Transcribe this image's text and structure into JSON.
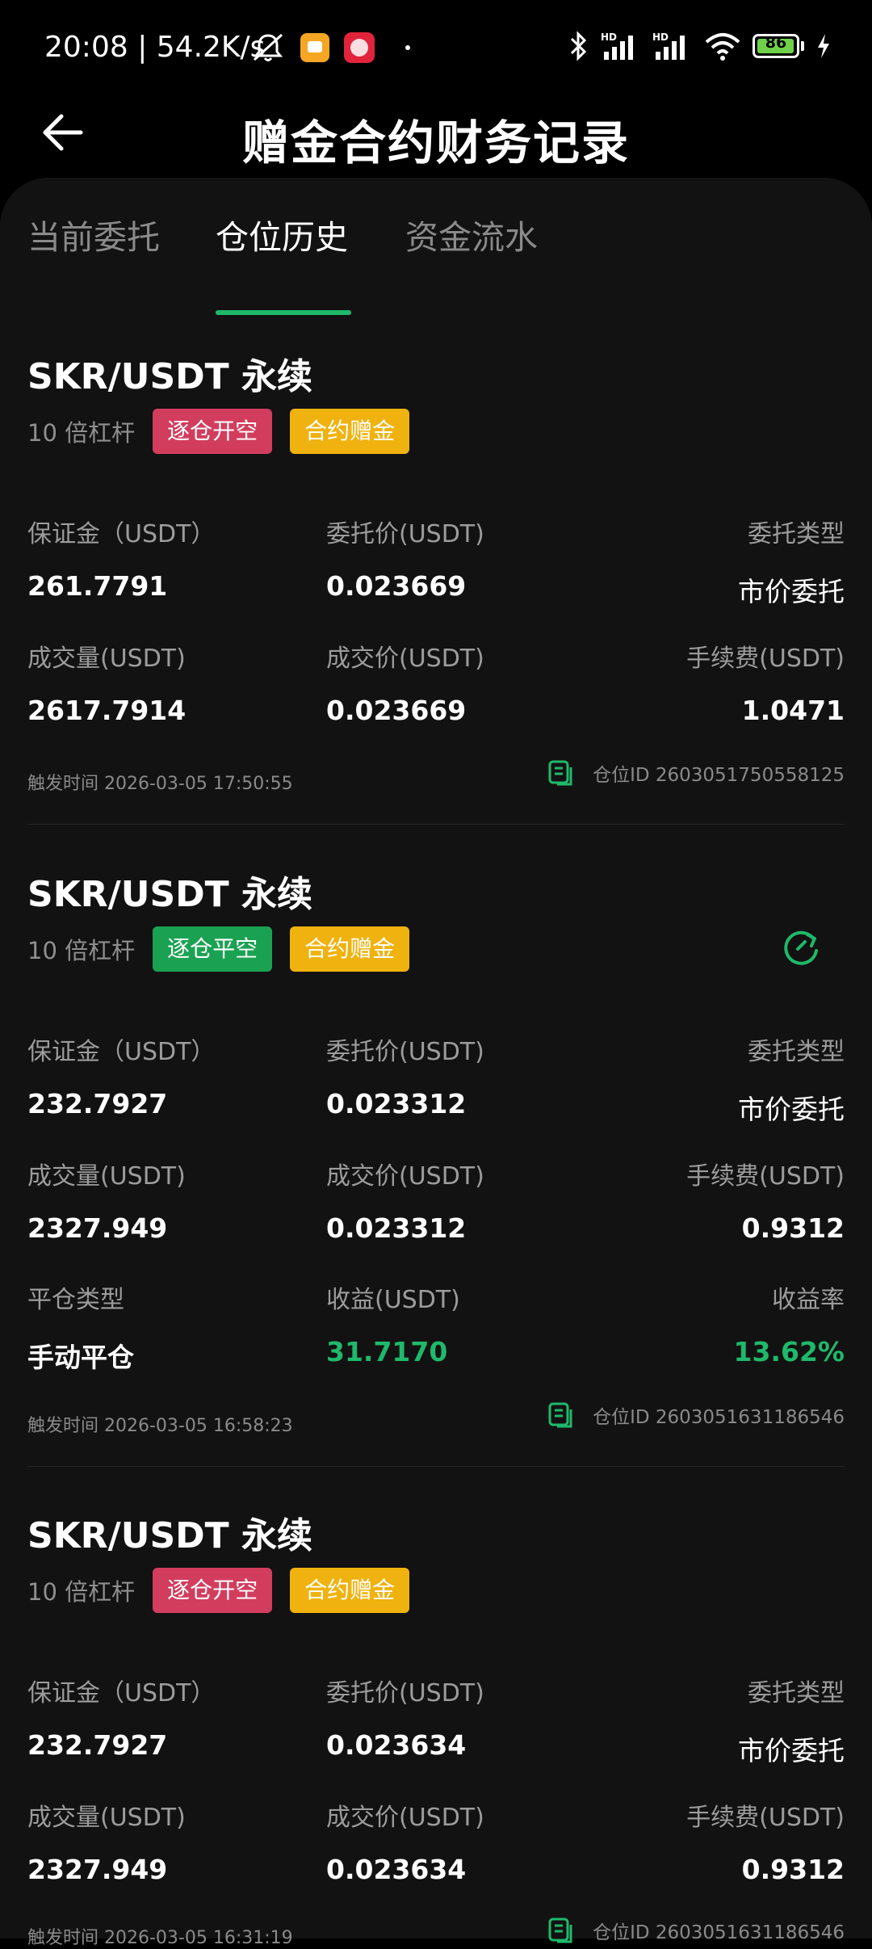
{
  "status_bar": {
    "time": "20:08 | 54.2K/s",
    "battery": "86"
  },
  "header": {
    "title": "赠金合约财务记录"
  },
  "tabs": [
    {
      "label": "当前委托",
      "active": false
    },
    {
      "label": "仓位历史",
      "active": true
    },
    {
      "label": "资金流水",
      "active": false
    }
  ],
  "labels": {
    "margin": "保证金（USDT）",
    "order_price": "委托价(USDT)",
    "order_type": "委托类型",
    "volume": "成交量(USDT)",
    "fill_price": "成交价(USDT)",
    "fee": "手续费(USDT)",
    "close_type": "平仓类型",
    "pnl": "收益(USDT)",
    "pnl_rate": "收益率"
  },
  "records": [
    {
      "pair": "SKR/USDT 永续",
      "leverage": "10 倍杠杆",
      "tag_action": "逐仓开空",
      "tag_kind": "合约赠金",
      "margin": "261.7791",
      "order_price": "0.023669",
      "order_type": "市价委托",
      "volume": "2617.7914",
      "fill_price": "0.023669",
      "fee": "1.0471",
      "trigger_time": "触发时间 2026-03-05 17:50:55",
      "position_id": "仓位ID 2603051750558125"
    },
    {
      "pair": "SKR/USDT 永续",
      "leverage": "10 倍杠杆",
      "tag_action": "逐仓平空",
      "tag_kind": "合约赠金",
      "margin": "232.7927",
      "order_price": "0.023312",
      "order_type": "市价委托",
      "volume": "2327.949",
      "fill_price": "0.023312",
      "fee": "0.9312",
      "close_type": "手动平仓",
      "pnl": "31.7170",
      "pnl_rate": "13.62%",
      "trigger_time": "触发时间 2026-03-05 16:58:23",
      "position_id": "仓位ID 2603051631186546"
    },
    {
      "pair": "SKR/USDT 永续",
      "leverage": "10 倍杠杆",
      "tag_action": "逐仓开空",
      "tag_kind": "合约赠金",
      "margin": "232.7927",
      "order_price": "0.023634",
      "order_type": "市价委托",
      "volume": "2327.949",
      "fill_price": "0.023634",
      "fee": "0.9312",
      "trigger_time": "触发时间 2026-03-05 16:31:19",
      "position_id": "仓位ID 2603051631186546"
    }
  ],
  "colors": {
    "accent_green": "#1fb96b",
    "tag_red": "#d23d5e",
    "tag_green": "#1aa252",
    "tag_yellow": "#f0b20e"
  }
}
